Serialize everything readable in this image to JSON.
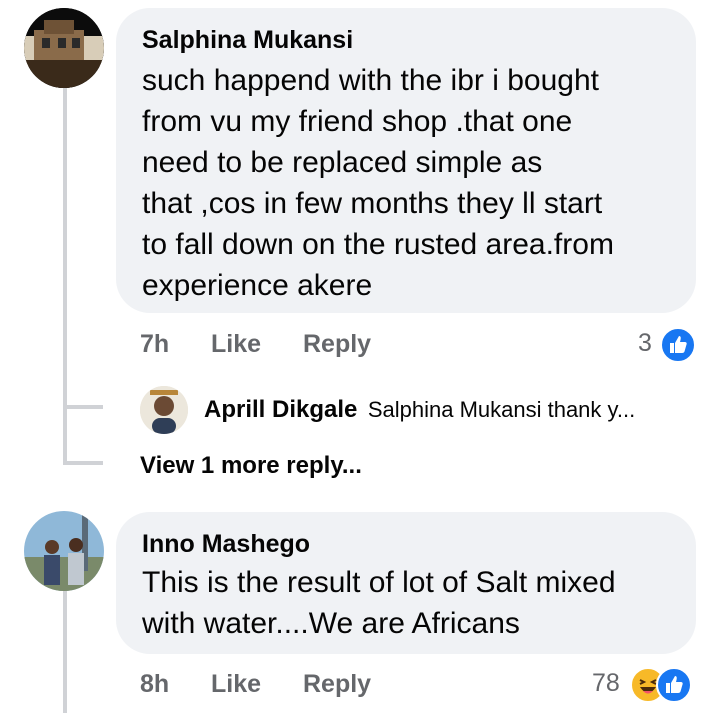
{
  "comments": [
    {
      "author": "Salphina Mukansi",
      "lines": [
        "such happend with the ibr i  bought",
        "from vu my friend shop .that one",
        "need to be replaced simple as",
        "that ,cos in few months they ll start",
        "to fall down on the rusted area.from",
        "experience akere"
      ],
      "time": "7h",
      "like_label": "Like",
      "reply_label": "Reply",
      "reaction_count": "3",
      "reaction_icons": [
        "like-icon"
      ],
      "reply_preview": {
        "author": "Aprill Dikgale",
        "text": "Salphina Mukansi thank y..."
      },
      "view_more": "View 1 more reply..."
    },
    {
      "author": "Inno Mashego",
      "lines": [
        "This is the result of  lot of Salt mixed",
        "with water....We are Africans"
      ],
      "time": "8h",
      "like_label": "Like",
      "reply_label": "Reply",
      "reaction_count": "78",
      "reaction_icons": [
        "haha-icon",
        "like-icon"
      ]
    }
  ],
  "colors": {
    "bubble": "#f0f2f5",
    "meta_text": "#65676b",
    "like_blue": "#1877f2",
    "haha_yellow": "#f7b928"
  }
}
